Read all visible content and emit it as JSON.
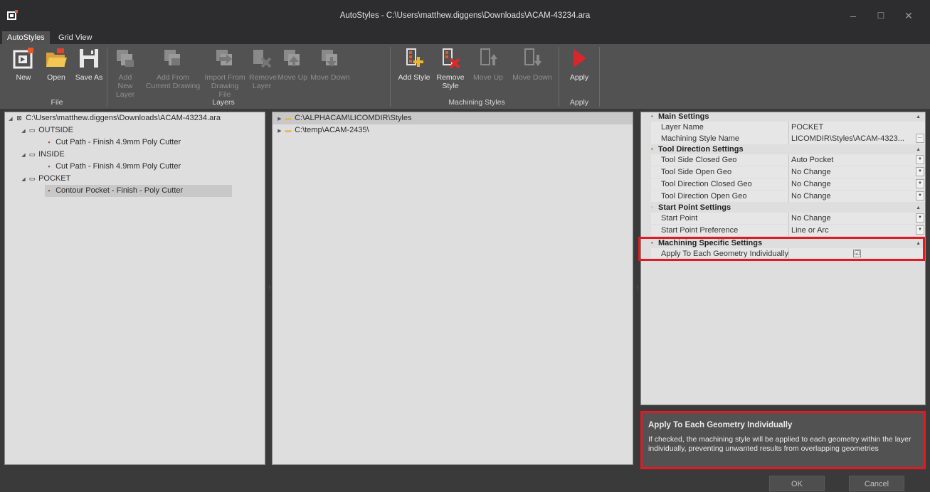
{
  "window": {
    "title": "AutoStyles - C:\\Users\\matthew.diggens\\Downloads\\ACAM-43234.ara",
    "minimize": "–",
    "maximize": "☐",
    "close": "✕"
  },
  "tabs": [
    {
      "label": "AutoStyles",
      "active": true
    },
    {
      "label": "Grid View",
      "active": false
    }
  ],
  "ribbon": {
    "file": {
      "label": "File",
      "buttons": [
        {
          "line1": "New",
          "line2": "",
          "icon": "new-icon"
        },
        {
          "line1": "Open",
          "line2": "",
          "icon": "open-folder-icon"
        },
        {
          "line1": "Save As",
          "line2": "",
          "icon": "save-icon"
        }
      ]
    },
    "layers": {
      "label": "Layers",
      "buttons": [
        {
          "line1": "Add New",
          "line2": "Layer"
        },
        {
          "line1": "Add From",
          "line2": "Current Drawing"
        },
        {
          "line1": "Import From",
          "line2": "Drawing File"
        },
        {
          "line1": "Remove",
          "line2": "Layer"
        },
        {
          "line1": "Move Up",
          "line2": ""
        },
        {
          "line1": "Move Down",
          "line2": ""
        }
      ]
    },
    "machining_styles": {
      "label": "Machining Styles",
      "buttons": [
        {
          "line1": "Add Style",
          "line2": ""
        },
        {
          "line1": "Remove",
          "line2": "Style"
        },
        {
          "line1": "Move Up",
          "line2": ""
        },
        {
          "line1": "Move Down",
          "line2": ""
        }
      ]
    },
    "apply": {
      "label": "Apply",
      "buttons": [
        {
          "line1": "Apply",
          "line2": ""
        }
      ]
    }
  },
  "layer_tree": {
    "root": "C:\\Users\\matthew.diggens\\Downloads\\ACAM-43234.ara",
    "layers": [
      {
        "name": "OUTSIDE",
        "style": "Cut Path - Finish 4.9mm Poly Cutter"
      },
      {
        "name": "INSIDE",
        "style": "Cut Path - Finish 4.9mm Poly Cutter"
      },
      {
        "name": "POCKET",
        "style": "Contour Pocket - Finish - Poly Cutter"
      }
    ]
  },
  "style_folders": [
    "C:\\ALPHACAM\\LICOMDIR\\Styles",
    "C:\\temp\\ACAM-2435\\"
  ],
  "properties": {
    "main": {
      "title": "Main Settings",
      "layer_name_label": "Layer Name",
      "layer_name_value": "POCKET",
      "style_name_label": "Machining Style Name",
      "style_name_value": "LICOMDIR\\Styles\\ACAM-4323...",
      "ellipsis": "···"
    },
    "tool_direction": {
      "title": "Tool Direction Settings",
      "rows": [
        {
          "label": "Tool Side Closed Geo",
          "value": "Auto Pocket"
        },
        {
          "label": "Tool Side Open Geo",
          "value": "No Change"
        },
        {
          "label": "Tool Direction Closed Geo",
          "value": "No Change"
        },
        {
          "label": "Tool Direction Open Geo",
          "value": "No Change"
        }
      ]
    },
    "start_point": {
      "title": "Start Point Settings",
      "rows": [
        {
          "label": "Start Point",
          "value": "No Change"
        },
        {
          "label": "Start Point Preference",
          "value": "Line or Arc"
        }
      ]
    },
    "machining_specific": {
      "title": "Machining Specific Settings",
      "apply_label": "Apply To Each Geometry Individually",
      "apply_checked": "☑"
    }
  },
  "description": {
    "title": "Apply To Each Geometry Individually",
    "body": "If checked, the machining style will be applied to each geometry within the layer individually, preventing unwanted results from overlapping geometries"
  },
  "footer": {
    "ok": "OK",
    "cancel": "Cancel"
  },
  "colors": {
    "highlight": "#e01b24",
    "apply_red": "#d9262c",
    "folder_yellow": "#e8b64a"
  }
}
